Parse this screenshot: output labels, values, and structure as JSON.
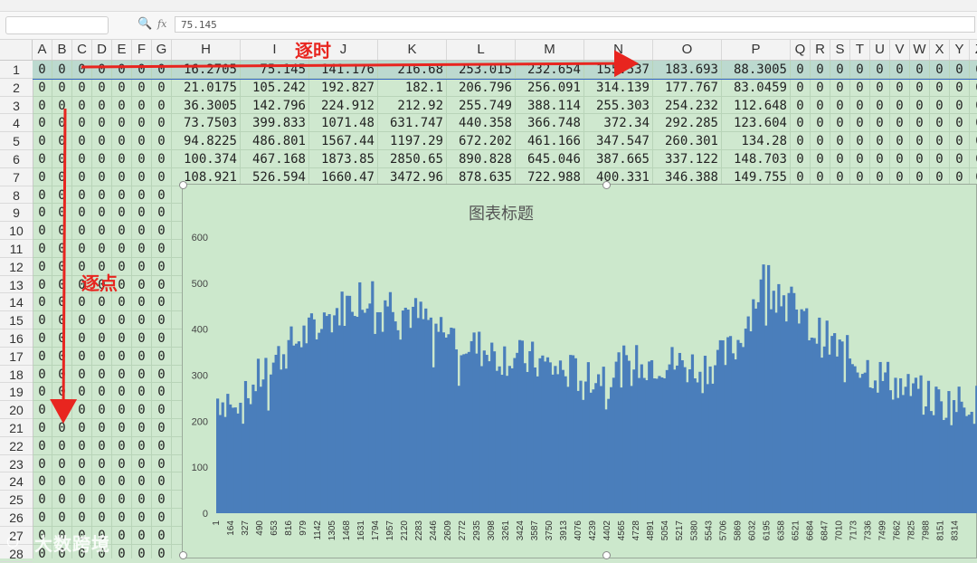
{
  "formula_bar": {
    "value": "75.145",
    "fx_label": "fx"
  },
  "columns": [
    "A",
    "B",
    "C",
    "D",
    "E",
    "F",
    "G",
    "H",
    "I",
    "J",
    "K",
    "L",
    "M",
    "N",
    "O",
    "P",
    "Q",
    "R",
    "S",
    "T",
    "U",
    "V",
    "W",
    "X",
    "Y",
    "Z"
  ],
  "rows": [
    [
      "0",
      "0",
      "0",
      "0",
      "0",
      "0",
      "0",
      "16.2705",
      "75.145",
      "141.176",
      "216.68",
      "253.015",
      "232.654",
      "155.537",
      "183.693",
      "88.3005",
      "0",
      "0",
      "0",
      "0",
      "0",
      "0",
      "0",
      "0",
      "0",
      "0"
    ],
    [
      "0",
      "0",
      "0",
      "0",
      "0",
      "0",
      "0",
      "21.0175",
      "105.242",
      "192.827",
      "182.1",
      "206.796",
      "256.091",
      "314.139",
      "177.767",
      "83.0459",
      "0",
      "0",
      "0",
      "0",
      "0",
      "0",
      "0",
      "0",
      "0",
      "0"
    ],
    [
      "0",
      "0",
      "0",
      "0",
      "0",
      "0",
      "0",
      "36.3005",
      "142.796",
      "224.912",
      "212.92",
      "255.749",
      "388.114",
      "255.303",
      "254.232",
      "112.648",
      "0",
      "0",
      "0",
      "0",
      "0",
      "0",
      "0",
      "0",
      "0",
      "0"
    ],
    [
      "0",
      "0",
      "0",
      "0",
      "0",
      "0",
      "0",
      "73.7503",
      "399.833",
      "1071.48",
      "631.747",
      "440.358",
      "366.748",
      "372.34",
      "292.285",
      "123.604",
      "0",
      "0",
      "0",
      "0",
      "0",
      "0",
      "0",
      "0",
      "0",
      "0"
    ],
    [
      "0",
      "0",
      "0",
      "0",
      "0",
      "0",
      "0",
      "94.8225",
      "486.801",
      "1567.44",
      "1197.29",
      "672.202",
      "461.166",
      "347.547",
      "260.301",
      "134.28",
      "0",
      "0",
      "0",
      "0",
      "0",
      "0",
      "0",
      "0",
      "0",
      "0"
    ],
    [
      "0",
      "0",
      "0",
      "0",
      "0",
      "0",
      "0",
      "100.374",
      "467.168",
      "1873.85",
      "2850.65",
      "890.828",
      "645.046",
      "387.665",
      "337.122",
      "148.703",
      "0",
      "0",
      "0",
      "0",
      "0",
      "0",
      "0",
      "0",
      "0",
      "0"
    ],
    [
      "0",
      "0",
      "0",
      "0",
      "0",
      "0",
      "0",
      "108.921",
      "526.594",
      "1660.47",
      "3472.96",
      "878.635",
      "722.988",
      "400.331",
      "346.388",
      "149.755",
      "0",
      "0",
      "0",
      "0",
      "0",
      "0",
      "0",
      "0",
      "0",
      "0"
    ]
  ],
  "row_numbers": [
    "1",
    "2",
    "3",
    "4",
    "5",
    "6",
    "7",
    "8",
    "9",
    "10",
    "11",
    "12",
    "13",
    "14",
    "15",
    "16",
    "17",
    "18",
    "19",
    "20",
    "21",
    "22",
    "23",
    "24",
    "25",
    "26",
    "27",
    "28"
  ],
  "annotations": {
    "time_label": "逐时",
    "point_label": "逐点"
  },
  "watermark": "大数跨境",
  "colors": {
    "arrow": "#e8251f",
    "bar": "#4a7ebb",
    "sheet_bg": "#cfe8cf"
  },
  "chart_data": {
    "type": "bar",
    "title": "图表标题",
    "ylim": [
      0,
      600
    ],
    "yticks": [
      "0",
      "100",
      "200",
      "300",
      "400",
      "500",
      "600"
    ],
    "xticks": [
      "1",
      "164",
      "327",
      "490",
      "653",
      "816",
      "979",
      "1142",
      "1305",
      "1468",
      "1631",
      "1794",
      "1957",
      "2120",
      "2283",
      "2446",
      "2609",
      "2772",
      "2935",
      "3098",
      "3261",
      "3424",
      "3587",
      "3750",
      "3913",
      "4076",
      "4239",
      "4402",
      "4565",
      "4728",
      "4891",
      "5054",
      "5217",
      "5380",
      "5543",
      "5706",
      "5869",
      "6032",
      "6195",
      "6358",
      "6521",
      "6684",
      "6847",
      "7010",
      "7173",
      "7336",
      "7499",
      "7662",
      "7825",
      "7988",
      "8151",
      "8314"
    ],
    "profile": [
      [
        0,
        250
      ],
      [
        5,
        245
      ],
      [
        12,
        260
      ],
      [
        20,
        235
      ],
      [
        30,
        285
      ],
      [
        40,
        320
      ],
      [
        50,
        345
      ],
      [
        60,
        370
      ],
      [
        70,
        390
      ],
      [
        80,
        405
      ],
      [
        90,
        430
      ],
      [
        100,
        450
      ],
      [
        110,
        470
      ],
      [
        120,
        480
      ],
      [
        130,
        470
      ],
      [
        140,
        455
      ],
      [
        150,
        440
      ],
      [
        160,
        425
      ],
      [
        170,
        410
      ],
      [
        180,
        395
      ],
      [
        190,
        380
      ],
      [
        200,
        365
      ],
      [
        210,
        355
      ],
      [
        220,
        345
      ],
      [
        230,
        340
      ],
      [
        240,
        335
      ],
      [
        250,
        330
      ],
      [
        260,
        320
      ],
      [
        270,
        310
      ],
      [
        280,
        305
      ],
      [
        290,
        300
      ],
      [
        300,
        300
      ],
      [
        310,
        310
      ],
      [
        320,
        320
      ],
      [
        330,
        325
      ],
      [
        340,
        330
      ],
      [
        350,
        330
      ],
      [
        360,
        325
      ],
      [
        370,
        320
      ],
      [
        380,
        320
      ],
      [
        390,
        325
      ],
      [
        400,
        340
      ],
      [
        410,
        370
      ],
      [
        420,
        440
      ],
      [
        430,
        510
      ],
      [
        440,
        500
      ],
      [
        450,
        460
      ],
      [
        460,
        420
      ],
      [
        470,
        395
      ],
      [
        480,
        375
      ],
      [
        490,
        355
      ],
      [
        500,
        335
      ],
      [
        510,
        320
      ],
      [
        520,
        300
      ],
      [
        530,
        290
      ],
      [
        540,
        270
      ],
      [
        550,
        260
      ],
      [
        560,
        250
      ],
      [
        570,
        240
      ],
      [
        580,
        235
      ],
      [
        590,
        245
      ],
      [
        600,
        235
      ]
    ],
    "n_bars": 300,
    "seed": 7
  }
}
